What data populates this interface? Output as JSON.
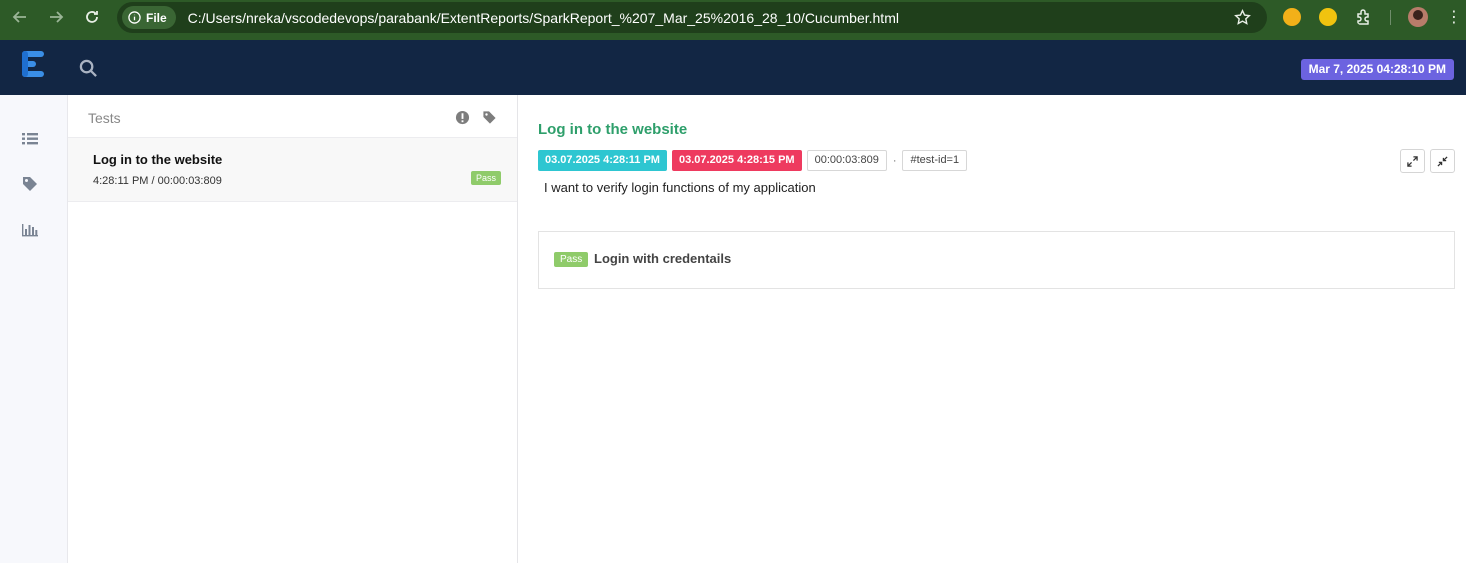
{
  "browser": {
    "file_label": "File",
    "url": "C:/Users/nreka/vscodedevops/parabank/ExtentReports/SparkReport_%207_Mar_25%2016_28_10/Cucumber.html",
    "kebab": "⋮"
  },
  "header": {
    "report_date": "Mar 7, 2025 04:28:10 PM",
    "accent_color": "#6c63e0"
  },
  "list": {
    "title": "Tests",
    "items": [
      {
        "name": "Log in to the website",
        "meta": "4:28:11 PM / 00:00:03:809",
        "status": "Pass"
      }
    ]
  },
  "detail": {
    "title": "Log in to the website",
    "start_time": "03.07.2025 4:28:11 PM",
    "end_time": "03.07.2025 4:28:15 PM",
    "duration": "00:00:03:809",
    "separator": "·",
    "test_id": "#test-id=1",
    "description": "I want to verify login functions of my application",
    "scenarios": [
      {
        "status": "Pass",
        "name": "Login with credentails"
      }
    ]
  }
}
